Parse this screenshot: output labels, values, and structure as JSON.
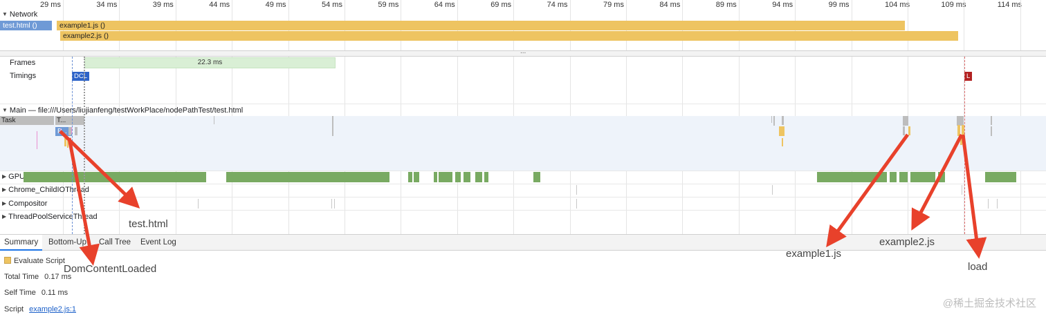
{
  "ruler": {
    "ticks": [
      "29 ms",
      "34 ms",
      "39 ms",
      "44 ms",
      "49 ms",
      "54 ms",
      "59 ms",
      "64 ms",
      "69 ms",
      "74 ms",
      "79 ms",
      "84 ms",
      "89 ms",
      "94 ms",
      "99 ms",
      "104 ms",
      "109 ms",
      "114 ms"
    ]
  },
  "network": {
    "label": "Network",
    "bars": {
      "test_html": "test.html ()",
      "example1": "example1.js ()",
      "example2": "example2.js ()"
    }
  },
  "splitter": {
    "dots": "..."
  },
  "frames": {
    "label": "Frames",
    "duration": "22.3 ms"
  },
  "timings": {
    "label": "Timings",
    "dcl": "DCL",
    "load": "L"
  },
  "main": {
    "title": "Main — file:///Users/liujianfeng/testWorkPlace/nodePathTest/test.html",
    "task_label": "Task",
    "t_label": "T...",
    "p_label": "P..."
  },
  "threads": {
    "gpu": "GPU",
    "childio": "Chrome_ChildIOThread",
    "compositor": "Compositor",
    "threadpool": "ThreadPoolServiceThread"
  },
  "tabs": {
    "summary": "Summary",
    "bottom_up": "Bottom-Up",
    "call_tree": "Call Tree",
    "event_log": "Event Log"
  },
  "summary": {
    "category": "Evaluate Script",
    "total_time_label": "Total Time",
    "total_time_value": "0.17 ms",
    "self_time_label": "Self Time",
    "self_time_value": "0.11 ms",
    "script_label": "Script",
    "script_link": "example2.js:1"
  },
  "annotations": {
    "test_html": "test.html",
    "dom_content_loaded": "DomContentLoaded",
    "example1": "example1.js",
    "example2": "example2.js",
    "load": "load"
  },
  "watermark": "@稀土掘金技术社区",
  "colors": {
    "html_bar": "#6f9ad6",
    "script_bar": "#eec461",
    "gpu": "#79aa62",
    "dcl": "#2d63c8",
    "load": "#b22222",
    "arrow": "#e8412b",
    "active_tab": "#1a73e8"
  }
}
